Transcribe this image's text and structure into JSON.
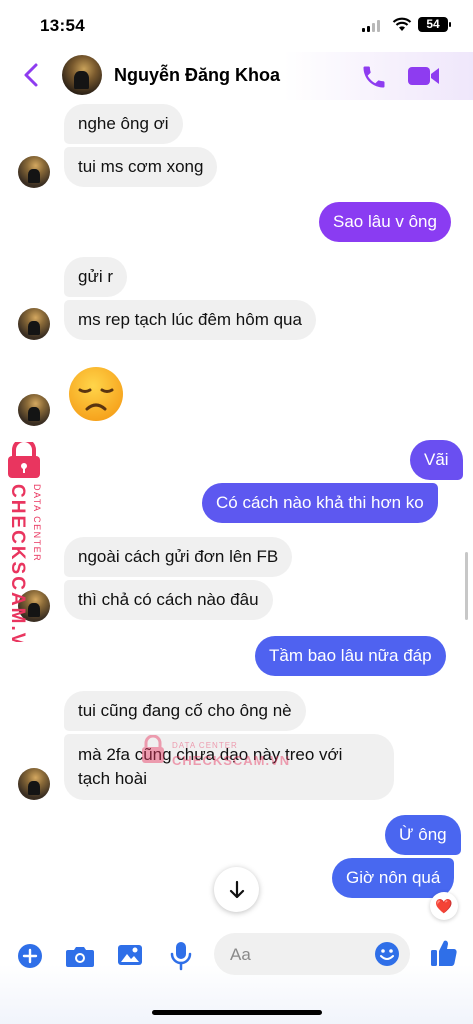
{
  "status_bar": {
    "time": "13:54",
    "battery": "54"
  },
  "header": {
    "contact_name": "Nguyễn Đăng Khoa"
  },
  "messages": [
    {
      "side": "in",
      "text": "nghe ông ơi"
    },
    {
      "side": "in",
      "text": "tui ms cơm xong"
    },
    {
      "side": "out",
      "text": "Sao lâu v ông"
    },
    {
      "side": "in",
      "text": "gửi r"
    },
    {
      "side": "in",
      "text": "ms rep tạch lúc đêm  hôm qua"
    },
    {
      "side": "in",
      "emoji": "disappointed-face"
    },
    {
      "side": "out",
      "text": "Vãi"
    },
    {
      "side": "out",
      "text": "Có cách nào khả thi hơn ko"
    },
    {
      "side": "in",
      "text": "ngoài cách gửi đơn  lên FB"
    },
    {
      "side": "in",
      "text": "thì chả có cách nào đâu"
    },
    {
      "side": "out",
      "text": "Tầm bao lâu nữa đáp"
    },
    {
      "side": "in",
      "text": "tui cũng đang cố cho ông nè"
    },
    {
      "side": "in",
      "text_line1": "mà 2fa cũng chưa dạo này treo với",
      "text_line2": "tạch hoài"
    },
    {
      "side": "out",
      "text": "Ừ ông"
    },
    {
      "side": "out",
      "text": "Giờ nôn quá",
      "reaction": "❤️"
    }
  ],
  "watermark": {
    "brand": "CHECKSCAM.VN",
    "tagline": "DATA CENTER"
  },
  "composer": {
    "placeholder": "Aa"
  },
  "colors": {
    "accent": "#8e3cf0",
    "outgoing_bubble_top": "#8a3cf2",
    "outgoing_bubble_bottom": "#4f62f0",
    "incoming_bubble": "#f0f0f0",
    "watermark": "#e9355f"
  },
  "icons": [
    "back-chevron-icon",
    "phone-icon",
    "video-camera-icon",
    "plus-icon",
    "camera-icon",
    "image-icon",
    "microphone-icon",
    "smile-icon",
    "thumbs-up-icon",
    "arrow-down-icon"
  ]
}
